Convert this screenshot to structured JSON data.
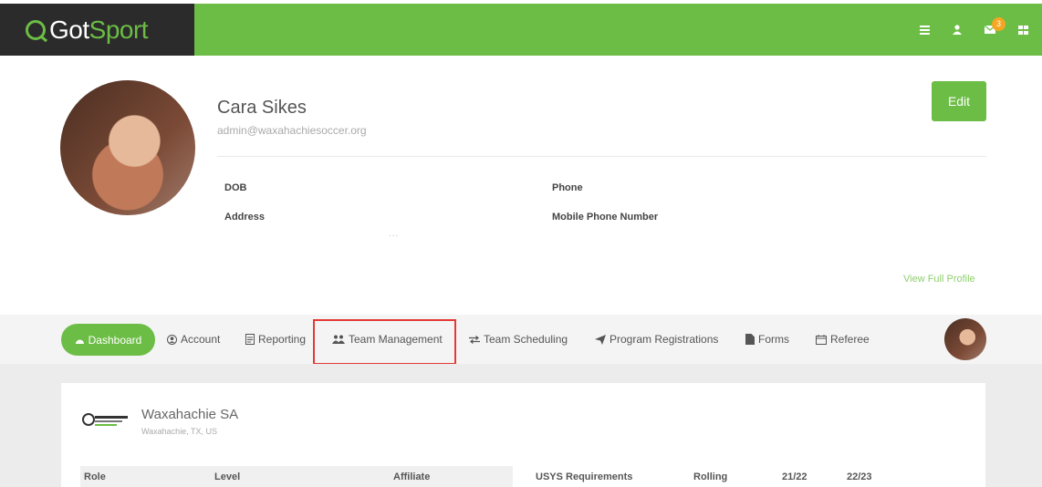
{
  "header": {
    "logo_got": "Got",
    "logo_sport": "Sport",
    "mail_badge": "3",
    "icons": [
      "list-icon",
      "user-icon",
      "mail-icon",
      "grid-menu-icon"
    ]
  },
  "profile": {
    "name": "Cara Sikes",
    "email": "admin@waxahachiesoccer.org",
    "edit_label": "Edit",
    "dob_label": "DOB",
    "phone_label": "Phone",
    "address_label": "Address",
    "mobile_label": "Mobile Phone Number",
    "dots": "...",
    "view_full_profile": "View Full Profile"
  },
  "nav": {
    "dashboard": "Dashboard",
    "account": "Account",
    "reporting": "Reporting",
    "team_management": "Team Management",
    "team_scheduling": "Team Scheduling",
    "program_registrations": "Program Registrations",
    "forms": "Forms",
    "referee": "Referee"
  },
  "org": {
    "name": "Waxahachie SA",
    "location": "Waxahachie, TX, US"
  },
  "table": {
    "col_role": "Role",
    "col_level": "Level",
    "col_affiliate": "Affiliate",
    "col_usys": "USYS Requirements",
    "col_rolling": "Rolling",
    "col_2122": "21/22",
    "col_2223": "22/23"
  },
  "colors": {
    "brand_green": "#6cbd45",
    "logo_dark": "#2b2b2b",
    "highlight_red": "#e53935",
    "badge_orange": "#f5a623"
  }
}
